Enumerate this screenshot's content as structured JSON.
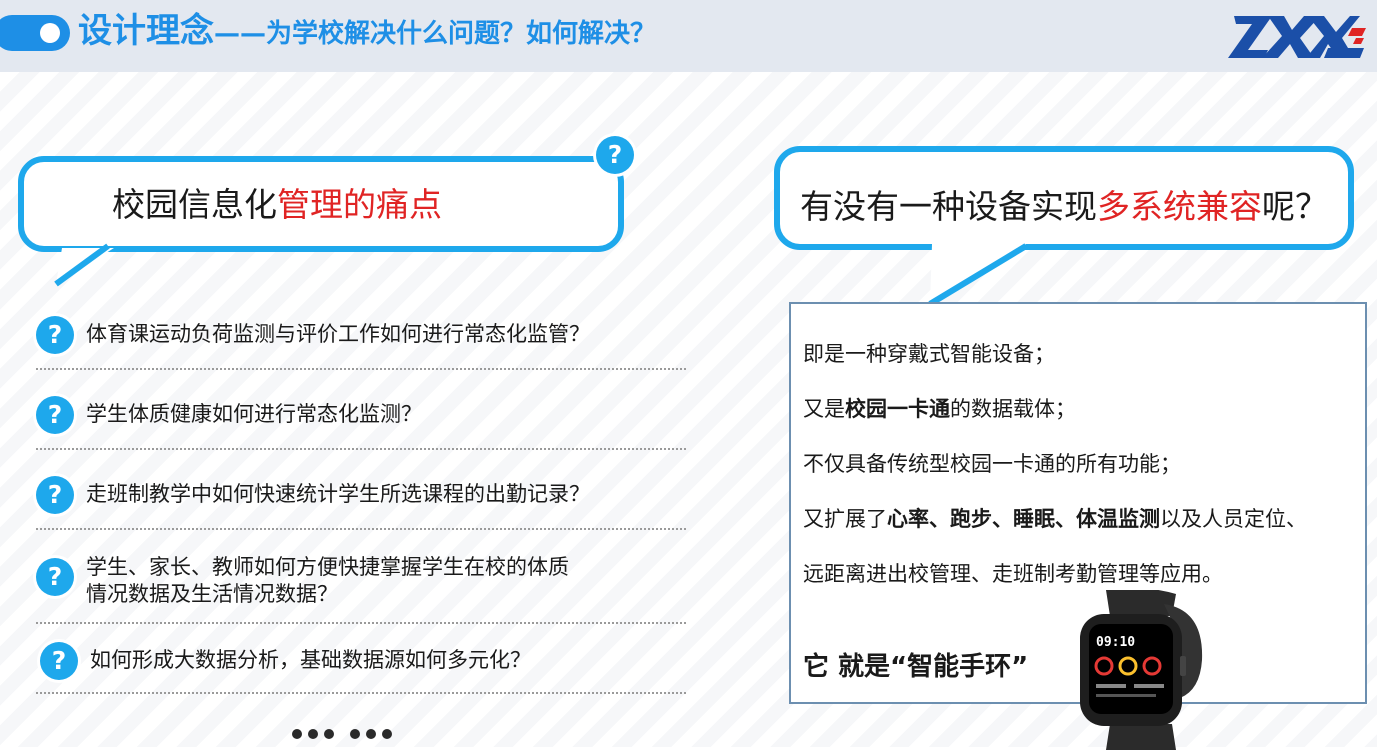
{
  "header": {
    "title_main": "设计理念",
    "title_sub": "——为学校解决什么问题？如何解决？",
    "logo_text": "ZXXL"
  },
  "left_bubble": {
    "text_plain": "校园信息化",
    "text_highlight": "管理的痛点",
    "badge": "?"
  },
  "questions": [
    {
      "badge": "?",
      "line1": "体育课运动负荷监测与评价工作如何进行常态化监管？",
      "line2": ""
    },
    {
      "badge": "?",
      "line1": "学生体质健康如何进行常态化监测？",
      "line2": ""
    },
    {
      "badge": "?",
      "line1": "走班制教学中如何快速统计学生所选课程的出勤记录？",
      "line2": ""
    },
    {
      "badge": "?",
      "line1": "学生、家长、教师如何方便快捷掌握学生在校的体质",
      "line2": "情况数据及生活情况数据？"
    },
    {
      "badge": "?",
      "line1": "如何形成大数据分析，基础数据源如何多元化？",
      "line2": ""
    }
  ],
  "right_bubble": {
    "text_plain": "有没有一种设备实现",
    "text_highlight": "多系统兼容",
    "text_end": "呢？"
  },
  "info": {
    "line1": "即是一种穿戴式智能设备；",
    "line2_pre": "又是",
    "line2_bold": "校园一卡通",
    "line2_post": "的数据载体；",
    "line3": "不仅具备传统型校园一卡通的所有功能；",
    "line4_pre": "又扩展了",
    "line4_bold": "心率、跑步、睡眠、体温监测",
    "line4_post": "以及人员定位、",
    "line5": "远距离进出校管理、走班制考勤管理等应用。",
    "answer": "它  就是“智能手环”"
  },
  "watch": {
    "time": "09:10"
  },
  "colors": {
    "accent": "#1ea8ec",
    "title_blue": "#1e8fe6",
    "highlight_red": "#e02424"
  }
}
